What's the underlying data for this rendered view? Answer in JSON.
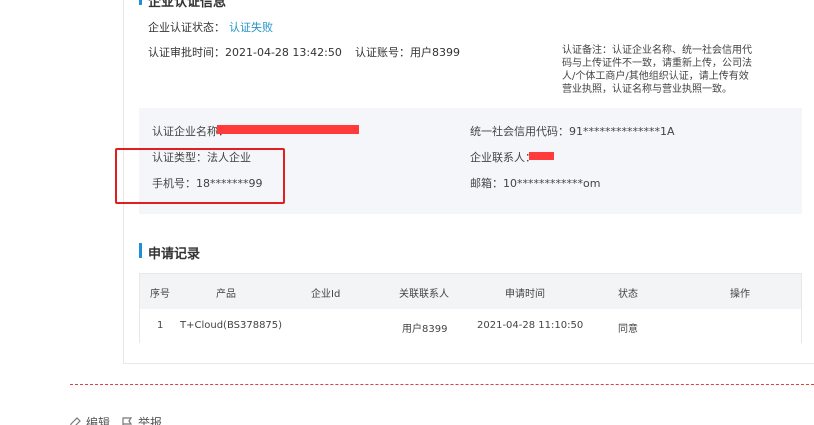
{
  "section_top": {
    "title": "企业认证信息"
  },
  "auth": {
    "status_label": "企业认证状态：",
    "status_value": "认证失败",
    "approve_time": "认证审批时间：2021-04-28 13:42:50",
    "account": "认证账号：用户8399",
    "remark": "认证备注：认证企业名称、统一社会信用代码与上传证件不一致，请重新上传，公司法人/个体工商户/其他组织认证，请上传有效营业执照，认证名称与营业执照一致。"
  },
  "company": {
    "name_label": "认证企业名称：",
    "credit_code": "统一社会信用代码：91**************1A",
    "type": "认证类型：法人企业",
    "contact_label": "企业联系人：",
    "phone": "手机号：18*******99",
    "email": "邮箱：10************om"
  },
  "records": {
    "title": "申请记录",
    "headers": [
      "序号",
      "产品",
      "企业Id",
      "关联联系人",
      "申请时间",
      "状态",
      "操作"
    ],
    "rows": [
      [
        "1",
        "T+Cloud(BS378875)",
        "",
        "用户8399",
        "2021-04-28 11:10:50",
        "同意",
        ""
      ]
    ]
  },
  "bottom": {
    "edit": "编辑",
    "report": "举报"
  },
  "colors": {
    "accent": "#1e90d8",
    "link": "#2196c8",
    "redact": "#ff3b3b",
    "highlight": "#e02020"
  }
}
